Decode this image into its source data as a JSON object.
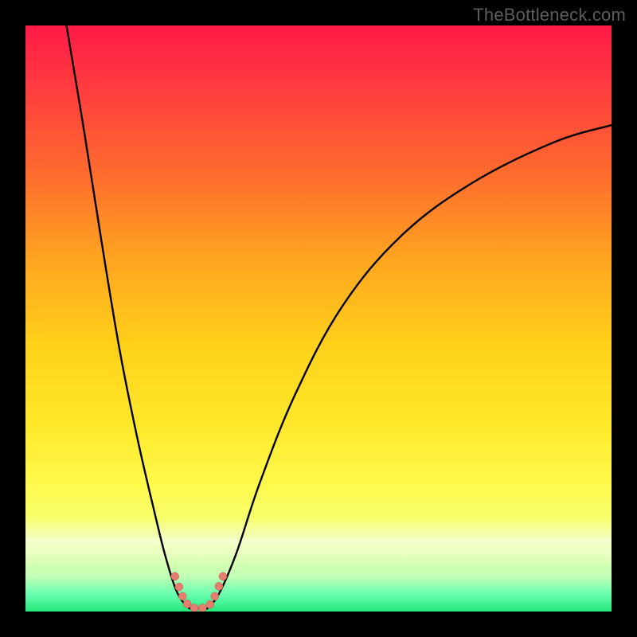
{
  "watermark": "TheBottleneck.com",
  "colors": {
    "frame_bg": "#000000",
    "gradient_top": "#ff1a47",
    "gradient_mid": "#ffe82a",
    "gradient_bottom": "#24e97b",
    "curve": "#000000",
    "marker_fill": "#e77d6e",
    "marker_stroke": "#b65748"
  },
  "chart_data": {
    "type": "line",
    "title": "",
    "xlabel": "",
    "ylabel": "",
    "x_range": [
      0,
      100
    ],
    "y_range": [
      0,
      100
    ],
    "gradient_meaning": "vertical color scale: red (high) at top → green (low) at bottom",
    "series": [
      {
        "name": "left-branch",
        "comment": "steep descending curve from upper-left toward the trough",
        "points": [
          {
            "x": 7,
            "y": 100
          },
          {
            "x": 10,
            "y": 82
          },
          {
            "x": 13,
            "y": 63
          },
          {
            "x": 16,
            "y": 45
          },
          {
            "x": 19,
            "y": 30
          },
          {
            "x": 22,
            "y": 17
          },
          {
            "x": 24,
            "y": 9
          },
          {
            "x": 26,
            "y": 3
          },
          {
            "x": 28,
            "y": 0.5
          }
        ]
      },
      {
        "name": "right-branch",
        "comment": "ascending curve from the trough sweeping up to the right edge",
        "points": [
          {
            "x": 31,
            "y": 0.5
          },
          {
            "x": 33,
            "y": 3
          },
          {
            "x": 36,
            "y": 10
          },
          {
            "x": 40,
            "y": 22
          },
          {
            "x": 46,
            "y": 37
          },
          {
            "x": 54,
            "y": 52
          },
          {
            "x": 64,
            "y": 64
          },
          {
            "x": 76,
            "y": 73
          },
          {
            "x": 90,
            "y": 80
          },
          {
            "x": 100,
            "y": 83
          }
        ]
      }
    ],
    "trough_floor": {
      "comment": "flat connector between the two branches just above y=0",
      "points": [
        {
          "x": 28,
          "y": 0.5
        },
        {
          "x": 31,
          "y": 0.5
        }
      ]
    },
    "markers": {
      "comment": "pink/salmon bead clusters near the bottom of the V",
      "points": [
        {
          "x": 25.5,
          "y": 6.0
        },
        {
          "x": 26.2,
          "y": 4.2
        },
        {
          "x": 26.8,
          "y": 2.6
        },
        {
          "x": 27.6,
          "y": 1.3
        },
        {
          "x": 28.8,
          "y": 0.6
        },
        {
          "x": 30.2,
          "y": 0.6
        },
        {
          "x": 31.5,
          "y": 1.2
        },
        {
          "x": 32.3,
          "y": 2.6
        },
        {
          "x": 33.0,
          "y": 4.3
        },
        {
          "x": 33.7,
          "y": 6.0
        }
      ],
      "radius": 5
    },
    "shimmer_band": {
      "top_pct": 84,
      "height_pct": 8
    }
  }
}
